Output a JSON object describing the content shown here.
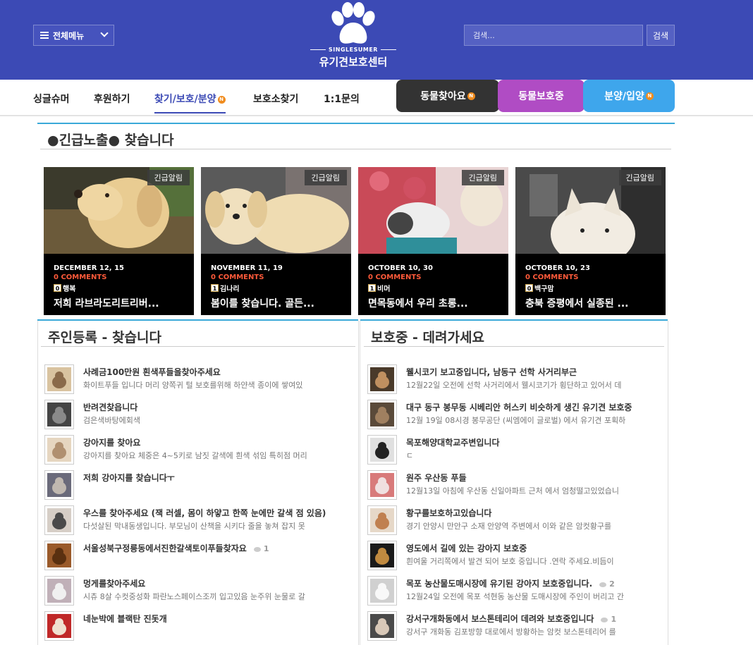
{
  "header": {
    "menu_label": "전체메뉴",
    "brand_small": "SINGLESUMER",
    "brand_big": "유기견보호센터",
    "search_placeholder": "검색...",
    "search_button": "검색"
  },
  "nav": {
    "items": [
      "싱글슈머",
      "후원하기",
      "찾기/보호/분양",
      "보호소찾기",
      "1:1문의"
    ],
    "new_badge": "N",
    "tabs": [
      {
        "label": "동물찾아요",
        "color": "#333333"
      },
      {
        "label": "동물보호중",
        "color": "#b04cc4"
      },
      {
        "label": "분양/입양",
        "color": "#3ea6ec"
      }
    ]
  },
  "urgent": {
    "heading": "●긴급노출● 찾습니다",
    "badge": "긴급알림",
    "cards": [
      {
        "date": "DECEMBER 12, 15",
        "comments": "0 COMMENTS",
        "level": "0",
        "author": "행복",
        "title": "저희 라브라도리트리버..."
      },
      {
        "date": "NOVEMBER 11, 19",
        "comments": "0 COMMENTS",
        "level": "1",
        "author": "김나리",
        "title": "봄이를 찾습니다. 골든..."
      },
      {
        "date": "OCTOBER 10, 30",
        "comments": "0 COMMENTS",
        "level": "1",
        "author": "비머",
        "title": "면목동에서 우리 초롱..."
      },
      {
        "date": "OCTOBER 10, 23",
        "comments": "0 COMMENTS",
        "level": "0",
        "author": "백구맘",
        "title": "충북 증평에서 실종된 ..."
      }
    ]
  },
  "left_section": {
    "heading": "주인등록 - 찾습니다",
    "items": [
      {
        "title": "사례금100만원 흰색푸들을찾아주세요",
        "sub": "화이트푸들 입니다 머리 양쪽귀 털 보호를위해 하얀색 종이에 쌓여있",
        "comments": ""
      },
      {
        "title": "반려견찾읍니다",
        "sub": "검은색바탕에회색",
        "comments": ""
      },
      {
        "title": "강아지를 찾아요",
        "sub": "강아지를 찾아요 체중은 4~5키로 남짓 갈색에 흰색 섞임 특히점 머리",
        "comments": ""
      },
      {
        "title": "저희 강아지를 찾습니다ㅜ",
        "sub": "",
        "comments": ""
      },
      {
        "title": "우스를 찾아주세요 (잭 러셀, 몸이 하얗고 한쪽 눈에만 갈색 점 있음)",
        "sub": "다섯살된 막내동생입니다. 부모님이 산책을 시키다 줄을 놓쳐 잡지 못",
        "comments": ""
      },
      {
        "title": "서울성북구정릉동에서진한갈색토이푸들찾자요",
        "sub": "",
        "comments": "1"
      },
      {
        "title": "멍게를찾아주세요",
        "sub": "시츄 8살 수컷중성화 파란노스페이스조끼 입고있음 눈주위 눈물로 갈",
        "comments": ""
      },
      {
        "title": "네눈박에 블랙탄 진돗개",
        "sub": "",
        "comments": ""
      }
    ]
  },
  "right_section": {
    "heading": "보호중 - 데려가세요",
    "items": [
      {
        "title": "웰시코기 보고중입니다, 남동구 선학 사거리부근",
        "sub": "12월22일 오전에 선학 사거리에서 웰시코기가 횡단하고 있어서 데",
        "comments": ""
      },
      {
        "title": "대구 동구 봉무동 시베리안 허스키 비슷하게 생긴 유기견 보호중",
        "sub": "12월 19일 08시경 봉무공단 (씨엠에이 글로벌) 에서 유기견 포획하",
        "comments": ""
      },
      {
        "title": "목포해양대학교주변입니다",
        "sub": "ㄷ",
        "comments": ""
      },
      {
        "title": "원주 우산동 푸들",
        "sub": "12월13일 아침에 우산동 신일아파트 근처 에서 엄청떨고있었습니",
        "comments": ""
      },
      {
        "title": "황구를보호하고있습니다",
        "sub": "경기 안양시 만안구 소재 안양역 주변에서 이와 같은 암컷황구를",
        "comments": ""
      },
      {
        "title": "영도에서 길에 있는 강아지 보호중",
        "sub": "흰여울 거리쪽에서 발견 되어 보호 중입니다 .연락 주세요.비듬이",
        "comments": ""
      },
      {
        "title": "목포 농산물도매시장에 유기된 강아지 보호중입니다.",
        "sub": "12월24일 오전에 목포 석현동 농산물 도매시장에 주인이 버리고 간",
        "comments": "2"
      },
      {
        "title": "강서구개화동에서 보스톤테리어 데려와 보호중입니다",
        "sub": "강서구 개화동 김포방향 대로에서 방황하는 암컷 보스톤테리어 를",
        "comments": "1"
      }
    ]
  }
}
